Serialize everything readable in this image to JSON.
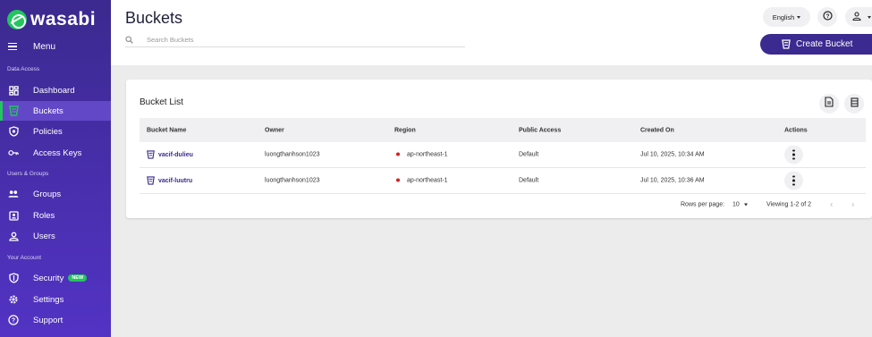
{
  "brand": {
    "name": "wasabi",
    "accent": "#22c55e",
    "primary": "#3b2a8f"
  },
  "sidebar": {
    "menu_label": "Menu",
    "sections": {
      "data_access": "Data Access",
      "users_groups": "Users & Groups",
      "your_account": "Your Account"
    },
    "items": [
      {
        "label": "Dashboard",
        "icon": "dashboard-icon"
      },
      {
        "label": "Buckets",
        "icon": "bucket-icon",
        "active": true
      },
      {
        "label": "Policies",
        "icon": "shield-icon"
      },
      {
        "label": "Access Keys",
        "icon": "key-icon"
      },
      {
        "label": "Groups",
        "icon": "group-icon"
      },
      {
        "label": "Roles",
        "icon": "badge-icon"
      },
      {
        "label": "Users",
        "icon": "user-icon"
      },
      {
        "label": "Security",
        "icon": "security-shield-icon",
        "badge": "NEW"
      },
      {
        "label": "Settings",
        "icon": "gear-icon"
      },
      {
        "label": "Support",
        "icon": "help-icon"
      }
    ]
  },
  "header": {
    "title": "Buckets",
    "search_placeholder": "Search Buckets",
    "language": "English",
    "create_button": "Create Bucket"
  },
  "card": {
    "title": "Bucket List",
    "columns": [
      "Bucket Name",
      "Owner",
      "Region",
      "Public Access",
      "Created On",
      "Actions"
    ],
    "rows": [
      {
        "name": "vacif-dulieu",
        "owner": "luongthanhson1023",
        "region": "ap-northeast-1",
        "public_access": "Default",
        "created_on": "Jul 10, 2025, 10:34 AM"
      },
      {
        "name": "vacif-luutru",
        "owner": "luongthanhson1023",
        "region": "ap-northeast-1",
        "public_access": "Default",
        "created_on": "Jul 10, 2025, 10:36 AM"
      }
    ],
    "footer": {
      "rows_per_page_label": "Rows per page:",
      "rows_per_page_value": "10",
      "viewing": "Viewing 1-2 of 2"
    }
  }
}
